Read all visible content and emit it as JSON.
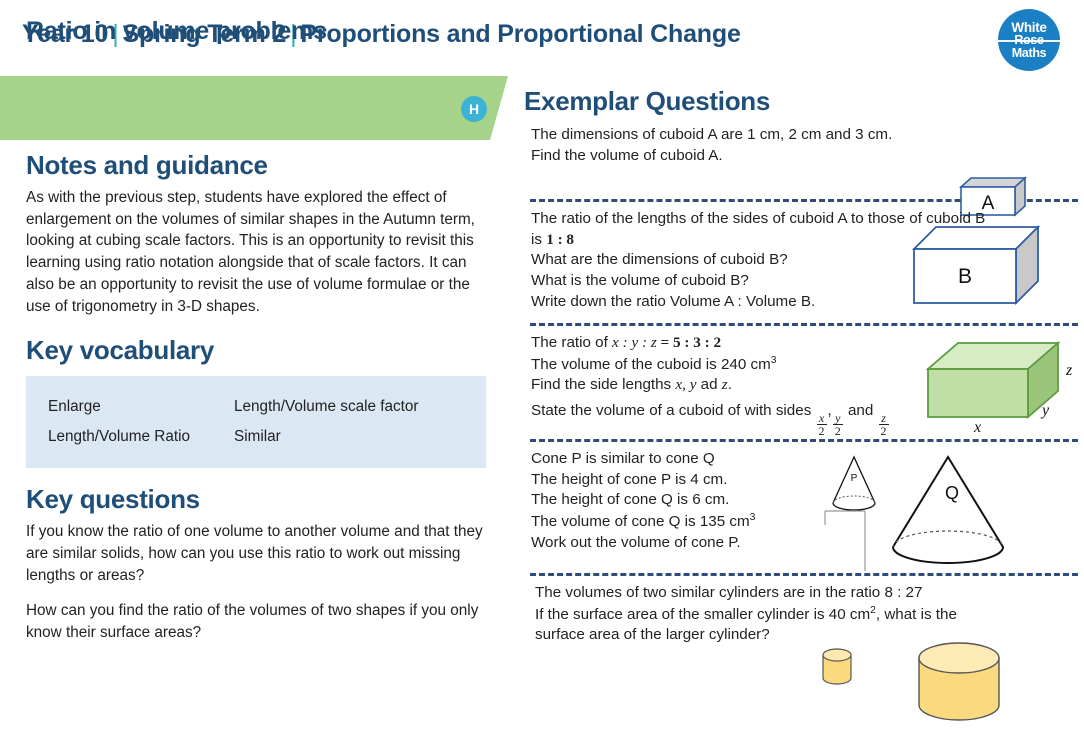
{
  "header": {
    "year": "Year 10",
    "term": "Spring Term  2",
    "topic": "Proportions and Proportional Change",
    "separator": "|",
    "logo": {
      "line1": "White",
      "line2": "Rose",
      "line3": "Maths"
    }
  },
  "banner": {
    "title": "Ratio in volume problems",
    "badge": "H",
    "bg_color": "#a5d38a",
    "badge_color": "#3ab3d4"
  },
  "left": {
    "notes_heading": "Notes and guidance",
    "notes_body": "As with the previous step, students have explored the effect of enlargement on the volumes of similar shapes in the Autumn term, looking at cubing scale factors. This is an opportunity to revisit this learning using ratio notation alongside that of scale factors. It can also be an opportunity to revisit the use of volume formulae or the use of trigonometry in 3-D shapes.",
    "vocab_heading": "Key vocabulary",
    "vocab": [
      {
        "left": "Enlarge",
        "right": "Length/Volume scale factor"
      },
      {
        "left": "Length/Volume Ratio",
        "right": "Similar"
      }
    ],
    "questions_heading": "Key questions",
    "questions": [
      "If you know the ratio of one volume to another volume and that they are similar solids, how can you use this ratio to work out missing lengths or areas?",
      "How can you find the ratio of the volumes of two shapes if you only know their surface areas?"
    ]
  },
  "right": {
    "heading": "Exemplar Questions",
    "q1": {
      "lines": [
        "The dimensions of cuboid A are 1 cm, 2 cm and 3 cm.",
        "Find the volume of cuboid A."
      ],
      "diagram_label": "A"
    },
    "q2": {
      "line1": "The ratio of the lengths of the sides of cuboid A to those of cuboid B",
      "line2_pre": "is ",
      "line2_ratio": "1 :  8",
      "line3": "What are the dimensions of cuboid B?",
      "line4": "What is the volume of cuboid B?",
      "line5": "Write down the ratio Volume A : Volume B.",
      "diagram_label": "B"
    },
    "q3": {
      "line1_pre": "The ratio of ",
      "line1_vars": "x : y : z",
      "line1_eq": " = ",
      "line1_nums": "5 : 3 : 2",
      "line2_pre": "The volume of the cuboid is 240 cm",
      "line2_sup": "3",
      "line3_pre": "Find the side lengths ",
      "line3_vars": "x, y",
      "line3_post": " ad ",
      "line3_var2": "z",
      "line3_end": ".",
      "line4_pre": "State the volume of a cuboid of with sides ",
      "frac1_num": "x",
      "frac1_den": "2",
      "frac_sep1": ",",
      "frac2_num": "y",
      "frac2_den": "2",
      "frac_and": " and ",
      "frac3_num": "z",
      "frac3_den": "2",
      "labels": {
        "x": "x",
        "y": "y",
        "z": "z"
      }
    },
    "q4": {
      "lines": [
        "Cone P is similar to cone Q",
        "The height of cone P is 4 cm.",
        "The height of cone Q is 6 cm."
      ],
      "line4_pre": "The volume of cone Q is 135 cm",
      "line4_sup": "3",
      "line5": "Work out the volume of cone P.",
      "label_p": "P",
      "label_q": "Q"
    },
    "q5": {
      "line1": "The volumes of two similar cylinders are in the ratio 8 :  27",
      "line2_pre": "If the surface area of the smaller cylinder is 40 cm",
      "line2_sup": "2",
      "line2_post": ", what is the",
      "line3": "surface area of the larger cylinder?"
    }
  }
}
